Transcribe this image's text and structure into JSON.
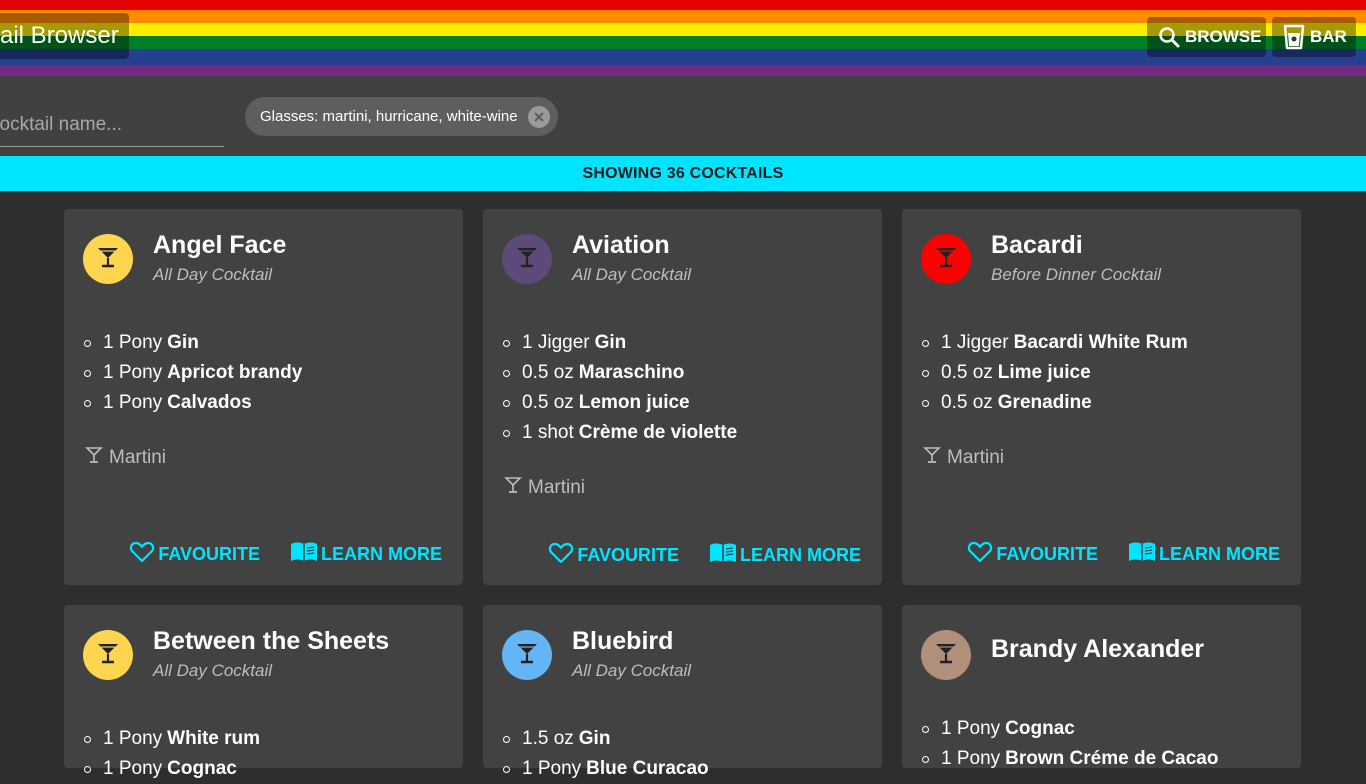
{
  "header": {
    "title": "ail Browser",
    "browse_label": "BROWSE",
    "bar_label": "BAR"
  },
  "filters": {
    "search_placeholder": "cocktail name...",
    "chip_label": "Glasses: martini, hurricane, white-wine"
  },
  "results": {
    "count_text": "SHOWING 36 COCKTAILS"
  },
  "actions": {
    "favourite_label": "FAVOURITE",
    "learn_more_label": "LEARN MORE"
  },
  "cards": [
    {
      "name": "Angel Face",
      "category": "All Day Cocktail",
      "color": "#ffd54f",
      "ingredients": [
        {
          "amount": "1 Pony",
          "name": "Gin"
        },
        {
          "amount": "1 Pony",
          "name": "Apricot brandy"
        },
        {
          "amount": "1 Pony",
          "name": "Calvados"
        }
      ],
      "glass": "Martini"
    },
    {
      "name": "Aviation",
      "category": "All Day Cocktail",
      "color": "#5e4a7a",
      "ingredients": [
        {
          "amount": "1 Jigger",
          "name": "Gin"
        },
        {
          "amount": "0.5 oz",
          "name": "Maraschino"
        },
        {
          "amount": "0.5 oz",
          "name": "Lemon juice"
        },
        {
          "amount": "1 shot",
          "name": "Crème de violette"
        }
      ],
      "glass": "Martini"
    },
    {
      "name": "Bacardi",
      "category": "Before Dinner Cocktail",
      "color": "#ff0000",
      "ingredients": [
        {
          "amount": "1 Jigger",
          "name": "Bacardi White Rum"
        },
        {
          "amount": "0.5 oz",
          "name": "Lime juice"
        },
        {
          "amount": "0.5 oz",
          "name": "Grenadine"
        }
      ],
      "glass": "Martini"
    },
    {
      "name": "Between the Sheets",
      "category": "All Day Cocktail",
      "color": "#ffd54f",
      "ingredients": [
        {
          "amount": "1 Pony",
          "name": "White rum"
        },
        {
          "amount": "1 Pony",
          "name": "Cognac"
        }
      ]
    },
    {
      "name": "Bluebird",
      "category": "All Day Cocktail",
      "color": "#64b5f6",
      "ingredients": [
        {
          "amount": "1.5 oz",
          "name": "Gin"
        },
        {
          "amount": "1 Pony",
          "name": "Blue Curacao"
        }
      ]
    },
    {
      "name": "Brandy Alexander",
      "category": "",
      "color": "#b0907a",
      "ingredients": [
        {
          "amount": "1 Pony",
          "name": "Cognac"
        },
        {
          "amount": "1 Pony",
          "name": "Brown Créme de Cacao"
        }
      ]
    }
  ]
}
